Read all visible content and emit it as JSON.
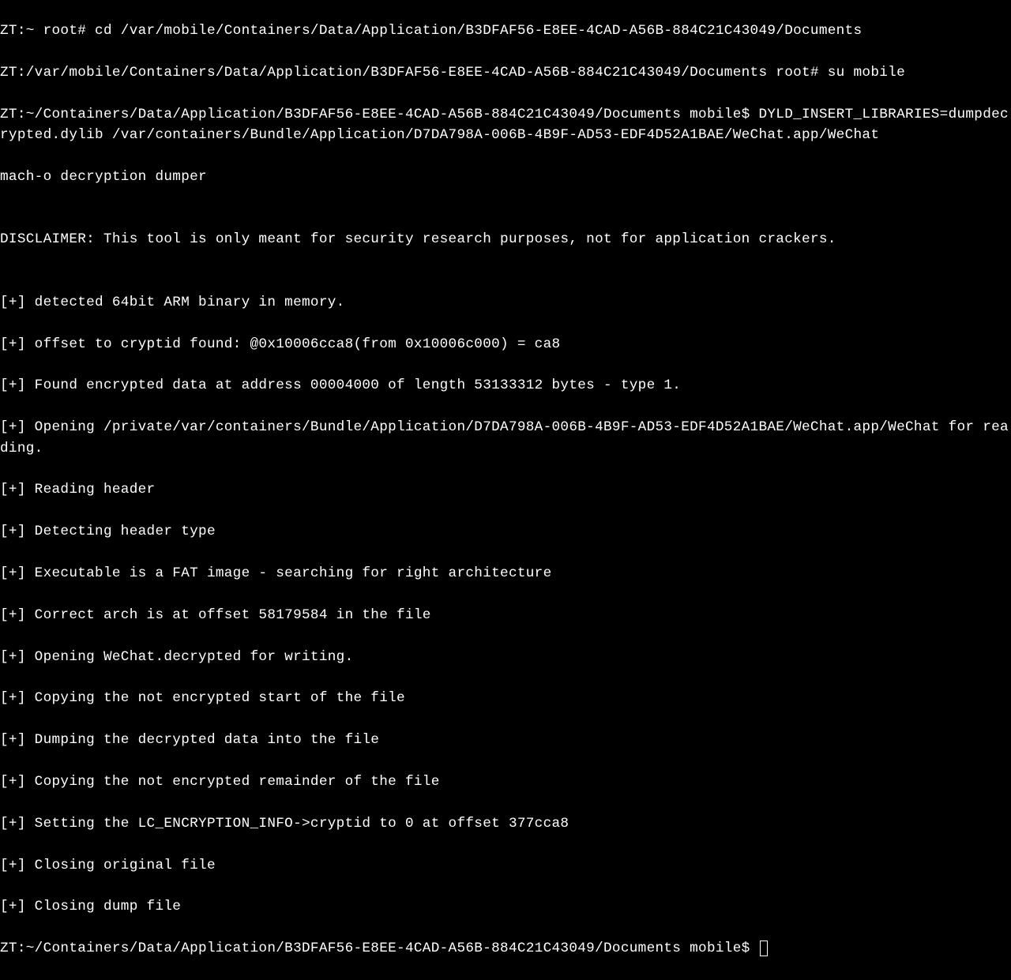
{
  "terminal": {
    "lines": [
      "ZT:~ root# cd /var/mobile/Containers/Data/Application/B3DFAF56-E8EE-4CAD-A56B-884C21C43049/Documents",
      "ZT:/var/mobile/Containers/Data/Application/B3DFAF56-E8EE-4CAD-A56B-884C21C43049/Documents root# su mobile",
      "ZT:~/Containers/Data/Application/B3DFAF56-E8EE-4CAD-A56B-884C21C43049/Documents mobile$ DYLD_INSERT_LIBRARIES=dumpdecrypted.dylib /var/containers/Bundle/Application/D7DA798A-006B-4B9F-AD53-EDF4D52A1BAE/WeChat.app/WeChat",
      "mach-o decryption dumper",
      "",
      "DISCLAIMER: This tool is only meant for security research purposes, not for application crackers.",
      "",
      "[+] detected 64bit ARM binary in memory.",
      "[+] offset to cryptid found: @0x10006cca8(from 0x10006c000) = ca8",
      "[+] Found encrypted data at address 00004000 of length 53133312 bytes - type 1.",
      "[+] Opening /private/var/containers/Bundle/Application/D7DA798A-006B-4B9F-AD53-EDF4D52A1BAE/WeChat.app/WeChat for reading.",
      "[+] Reading header",
      "[+] Detecting header type",
      "[+] Executable is a FAT image - searching for right architecture",
      "[+] Correct arch is at offset 58179584 in the file",
      "[+] Opening WeChat.decrypted for writing.",
      "[+] Copying the not encrypted start of the file",
      "[+] Dumping the decrypted data into the file",
      "[+] Copying the not encrypted remainder of the file",
      "[+] Setting the LC_ENCRYPTION_INFO->cryptid to 0 at offset 377cca8",
      "[+] Closing original file",
      "[+] Closing dump file"
    ],
    "prompt_final": "ZT:~/Containers/Data/Application/B3DFAF56-E8EE-4CAD-A56B-884C21C43049/Documents mobile$ "
  }
}
